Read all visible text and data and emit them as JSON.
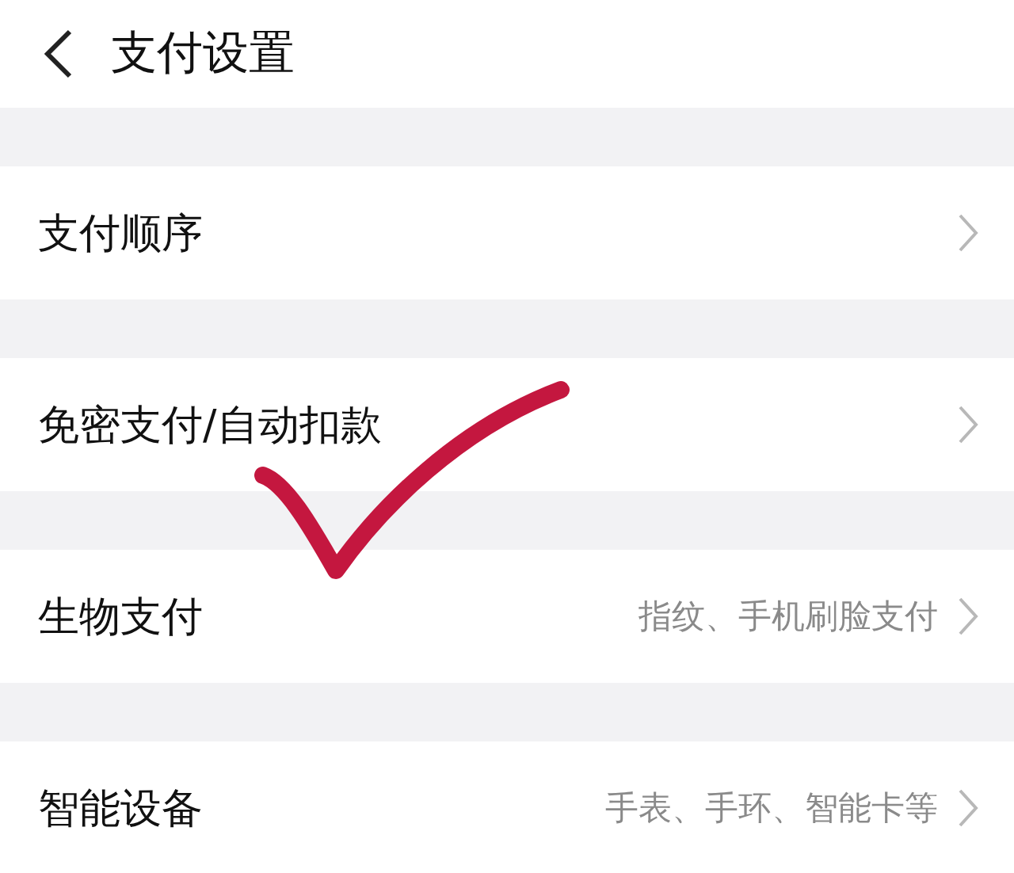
{
  "header": {
    "title": "支付设置"
  },
  "rows": [
    {
      "label": "支付顺序"
    },
    {
      "label": "免密支付/自动扣款"
    },
    {
      "label": "生物支付",
      "value": "指纹、手机刷脸支付"
    },
    {
      "label": "智能设备",
      "value": "手表、手环、智能卡等"
    }
  ],
  "annotation": {
    "kind": "checkmark"
  }
}
